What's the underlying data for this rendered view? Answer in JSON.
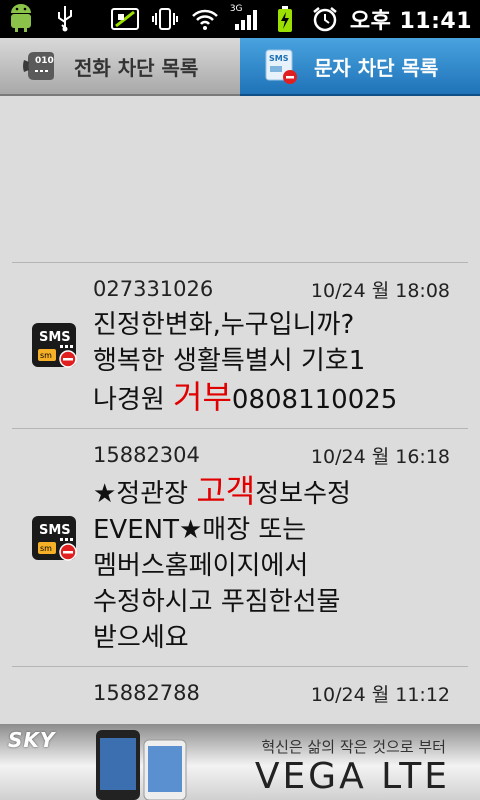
{
  "status_bar": {
    "time": "오후 11:41",
    "signal_label": "3G",
    "icons": [
      "android-icon",
      "usb-icon",
      "no-sim-icon",
      "vibrate-icon",
      "wifi-icon",
      "signal-icon",
      "battery-charging-icon",
      "alarm-icon"
    ]
  },
  "tabs": [
    {
      "label": "전화 차단 목록",
      "icon": "phone-010-icon",
      "selected": false
    },
    {
      "label": "문자 차단 목록",
      "icon": "sms-blocked-icon",
      "selected": true
    }
  ],
  "messages": [
    {
      "number": "027331026",
      "date": "10/24 월 18:08",
      "line1": "진정한변화,누구입니까?",
      "line2": "행복한 생활특별시 기호1",
      "line3_pre": "나경원 ",
      "line3_hl": "거부",
      "line3_post": "0808110025"
    },
    {
      "number": "15882304",
      "date": "10/24 월 16:18",
      "line1_pre": "★정관장 ",
      "line1_hl": "고객",
      "line1_post": "정보수정",
      "line2": "EVENT★매장 또는",
      "line3": "멤버스홈페이지에서",
      "line4": "수정하시고 푸짐한선물",
      "line5": "받으세요"
    },
    {
      "number": "15882788",
      "date": "10/24 월 11:12"
    }
  ],
  "sms_icon_text": {
    "top": "SMS",
    "bottom": "sm"
  },
  "ad": {
    "maker": "SKY",
    "slogan": "혁신은 삶의 작은 것으로 부터",
    "brand": "VEGA LTE"
  },
  "colors": {
    "tab_selected": "#2a86cc",
    "highlight": "#e00000",
    "background": "#dcdcdc"
  }
}
